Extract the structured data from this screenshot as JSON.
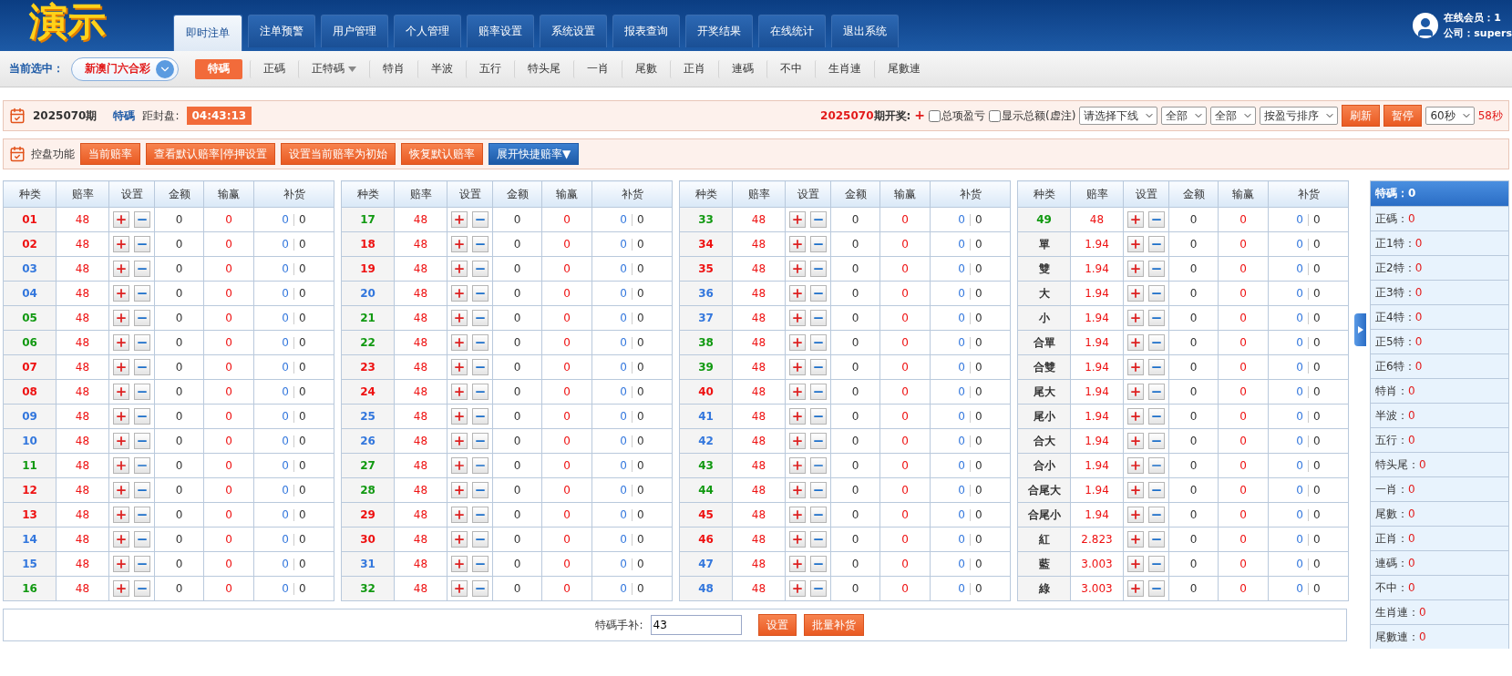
{
  "header": {
    "logo": "演示",
    "tabs": [
      {
        "label": "即时注单",
        "selected": true
      },
      {
        "label": "注单预警",
        "selected": false
      },
      {
        "label": "用户管理",
        "selected": false
      },
      {
        "label": "个人管理",
        "selected": false
      },
      {
        "label": "赔率设置",
        "selected": false
      },
      {
        "label": "系统设置",
        "selected": false
      },
      {
        "label": "报表查询",
        "selected": false
      },
      {
        "label": "开奖结果",
        "selected": false
      },
      {
        "label": "在线统计",
        "selected": false
      },
      {
        "label": "退出系统",
        "selected": false
      }
    ],
    "online": "在线会员：1",
    "company": "公司：supers"
  },
  "nav": {
    "label": "当前选中：",
    "game": "新澳门六合彩",
    "items": [
      {
        "label": "特碼",
        "selected": true,
        "kind": "link"
      },
      {
        "label": "正碼",
        "selected": false,
        "kind": "link"
      },
      {
        "label": "正特碼",
        "selected": false,
        "kind": "dropdown"
      },
      {
        "label": "特肖",
        "selected": false,
        "kind": "link"
      },
      {
        "label": "半波",
        "selected": false,
        "kind": "link"
      },
      {
        "label": "五行",
        "selected": false,
        "kind": "link"
      },
      {
        "label": "特头尾",
        "selected": false,
        "kind": "link"
      },
      {
        "label": "一肖",
        "selected": false,
        "kind": "link"
      },
      {
        "label": "尾數",
        "selected": false,
        "kind": "link"
      },
      {
        "label": "正肖",
        "selected": false,
        "kind": "link"
      },
      {
        "label": "連碼",
        "selected": false,
        "kind": "link"
      },
      {
        "label": "不中",
        "selected": false,
        "kind": "link"
      },
      {
        "label": "生肖連",
        "selected": false,
        "kind": "link"
      },
      {
        "label": "尾數連",
        "selected": false,
        "kind": "link"
      }
    ]
  },
  "info": {
    "period": "2025070期",
    "type": "特碼",
    "close_label": "距封盘:",
    "countdown": "04:43:13",
    "draw_period": "2025070",
    "draw_label": "期开奖:",
    "draw_mark": "+",
    "checkboxes": [
      {
        "label": "总项盈亏",
        "checked": false
      },
      {
        "label": "显示总额(虚注)",
        "checked": false
      }
    ],
    "selects": [
      "请选择下线",
      "全部",
      "全部",
      "按盈亏排序"
    ],
    "buttons": [
      "刷新",
      "暂停"
    ],
    "interval": "60秒",
    "remaining": "58秒"
  },
  "control": {
    "label": "控盘功能",
    "buttons": [
      {
        "label": "当前赔率",
        "kind": "orange"
      },
      {
        "label": "查看默认赔率|停押设置",
        "kind": "orange"
      },
      {
        "label": "设置当前赔率为初始",
        "kind": "orange"
      },
      {
        "label": "恢复默认赔率",
        "kind": "orange"
      },
      {
        "label": "展开快捷赔率▼",
        "kind": "blue"
      }
    ]
  },
  "tables": [
    {
      "columns": [
        "种类",
        "赔率",
        "设置",
        "金额",
        "输赢",
        "补货"
      ],
      "rows": [
        {
          "name": "01",
          "color": "#ee1111",
          "odds": "48",
          "amount": "0",
          "winloss": "0",
          "rebuy": "0",
          "rebuy_total": "0"
        },
        {
          "name": "02",
          "color": "#ee1111",
          "odds": "48",
          "amount": "0",
          "winloss": "0",
          "rebuy": "0",
          "rebuy_total": "0"
        },
        {
          "name": "03",
          "color": "#3377dd",
          "odds": "48",
          "amount": "0",
          "winloss": "0",
          "rebuy": "0",
          "rebuy_total": "0"
        },
        {
          "name": "04",
          "color": "#3377dd",
          "odds": "48",
          "amount": "0",
          "winloss": "0",
          "rebuy": "0",
          "rebuy_total": "0"
        },
        {
          "name": "05",
          "color": "#119911",
          "odds": "48",
          "amount": "0",
          "winloss": "0",
          "rebuy": "0",
          "rebuy_total": "0"
        },
        {
          "name": "06",
          "color": "#119911",
          "odds": "48",
          "amount": "0",
          "winloss": "0",
          "rebuy": "0",
          "rebuy_total": "0"
        },
        {
          "name": "07",
          "color": "#ee1111",
          "odds": "48",
          "amount": "0",
          "winloss": "0",
          "rebuy": "0",
          "rebuy_total": "0"
        },
        {
          "name": "08",
          "color": "#ee1111",
          "odds": "48",
          "amount": "0",
          "winloss": "0",
          "rebuy": "0",
          "rebuy_total": "0"
        },
        {
          "name": "09",
          "color": "#3377dd",
          "odds": "48",
          "amount": "0",
          "winloss": "0",
          "rebuy": "0",
          "rebuy_total": "0"
        },
        {
          "name": "10",
          "color": "#3377dd",
          "odds": "48",
          "amount": "0",
          "winloss": "0",
          "rebuy": "0",
          "rebuy_total": "0"
        },
        {
          "name": "11",
          "color": "#119911",
          "odds": "48",
          "amount": "0",
          "winloss": "0",
          "rebuy": "0",
          "rebuy_total": "0"
        },
        {
          "name": "12",
          "color": "#ee1111",
          "odds": "48",
          "amount": "0",
          "winloss": "0",
          "rebuy": "0",
          "rebuy_total": "0"
        },
        {
          "name": "13",
          "color": "#ee1111",
          "odds": "48",
          "amount": "0",
          "winloss": "0",
          "rebuy": "0",
          "rebuy_total": "0"
        },
        {
          "name": "14",
          "color": "#3377dd",
          "odds": "48",
          "amount": "0",
          "winloss": "0",
          "rebuy": "0",
          "rebuy_total": "0"
        },
        {
          "name": "15",
          "color": "#3377dd",
          "odds": "48",
          "amount": "0",
          "winloss": "0",
          "rebuy": "0",
          "rebuy_total": "0"
        },
        {
          "name": "16",
          "color": "#119911",
          "odds": "48",
          "amount": "0",
          "winloss": "0",
          "rebuy": "0",
          "rebuy_total": "0"
        }
      ]
    },
    {
      "columns": [
        "种类",
        "赔率",
        "设置",
        "金额",
        "输赢",
        "补货"
      ],
      "rows": [
        {
          "name": "17",
          "color": "#119911",
          "odds": "48",
          "amount": "0",
          "winloss": "0",
          "rebuy": "0",
          "rebuy_total": "0"
        },
        {
          "name": "18",
          "color": "#ee1111",
          "odds": "48",
          "amount": "0",
          "winloss": "0",
          "rebuy": "0",
          "rebuy_total": "0"
        },
        {
          "name": "19",
          "color": "#ee1111",
          "odds": "48",
          "amount": "0",
          "winloss": "0",
          "rebuy": "0",
          "rebuy_total": "0"
        },
        {
          "name": "20",
          "color": "#3377dd",
          "odds": "48",
          "amount": "0",
          "winloss": "0",
          "rebuy": "0",
          "rebuy_total": "0"
        },
        {
          "name": "21",
          "color": "#119911",
          "odds": "48",
          "amount": "0",
          "winloss": "0",
          "rebuy": "0",
          "rebuy_total": "0"
        },
        {
          "name": "22",
          "color": "#119911",
          "odds": "48",
          "amount": "0",
          "winloss": "0",
          "rebuy": "0",
          "rebuy_total": "0"
        },
        {
          "name": "23",
          "color": "#ee1111",
          "odds": "48",
          "amount": "0",
          "winloss": "0",
          "rebuy": "0",
          "rebuy_total": "0"
        },
        {
          "name": "24",
          "color": "#ee1111",
          "odds": "48",
          "amount": "0",
          "winloss": "0",
          "rebuy": "0",
          "rebuy_total": "0"
        },
        {
          "name": "25",
          "color": "#3377dd",
          "odds": "48",
          "amount": "0",
          "winloss": "0",
          "rebuy": "0",
          "rebuy_total": "0"
        },
        {
          "name": "26",
          "color": "#3377dd",
          "odds": "48",
          "amount": "0",
          "winloss": "0",
          "rebuy": "0",
          "rebuy_total": "0"
        },
        {
          "name": "27",
          "color": "#119911",
          "odds": "48",
          "amount": "0",
          "winloss": "0",
          "rebuy": "0",
          "rebuy_total": "0"
        },
        {
          "name": "28",
          "color": "#119911",
          "odds": "48",
          "amount": "0",
          "winloss": "0",
          "rebuy": "0",
          "rebuy_total": "0"
        },
        {
          "name": "29",
          "color": "#ee1111",
          "odds": "48",
          "amount": "0",
          "winloss": "0",
          "rebuy": "0",
          "rebuy_total": "0"
        },
        {
          "name": "30",
          "color": "#ee1111",
          "odds": "48",
          "amount": "0",
          "winloss": "0",
          "rebuy": "0",
          "rebuy_total": "0"
        },
        {
          "name": "31",
          "color": "#3377dd",
          "odds": "48",
          "amount": "0",
          "winloss": "0",
          "rebuy": "0",
          "rebuy_total": "0"
        },
        {
          "name": "32",
          "color": "#119911",
          "odds": "48",
          "amount": "0",
          "winloss": "0",
          "rebuy": "0",
          "rebuy_total": "0"
        }
      ]
    },
    {
      "columns": [
        "种类",
        "赔率",
        "设置",
        "金额",
        "输赢",
        "补货"
      ],
      "rows": [
        {
          "name": "33",
          "color": "#119911",
          "odds": "48",
          "amount": "0",
          "winloss": "0",
          "rebuy": "0",
          "rebuy_total": "0"
        },
        {
          "name": "34",
          "color": "#ee1111",
          "odds": "48",
          "amount": "0",
          "winloss": "0",
          "rebuy": "0",
          "rebuy_total": "0"
        },
        {
          "name": "35",
          "color": "#ee1111",
          "odds": "48",
          "amount": "0",
          "winloss": "0",
          "rebuy": "0",
          "rebuy_total": "0"
        },
        {
          "name": "36",
          "color": "#3377dd",
          "odds": "48",
          "amount": "0",
          "winloss": "0",
          "rebuy": "0",
          "rebuy_total": "0"
        },
        {
          "name": "37",
          "color": "#3377dd",
          "odds": "48",
          "amount": "0",
          "winloss": "0",
          "rebuy": "0",
          "rebuy_total": "0"
        },
        {
          "name": "38",
          "color": "#119911",
          "odds": "48",
          "amount": "0",
          "winloss": "0",
          "rebuy": "0",
          "rebuy_total": "0"
        },
        {
          "name": "39",
          "color": "#119911",
          "odds": "48",
          "amount": "0",
          "winloss": "0",
          "rebuy": "0",
          "rebuy_total": "0"
        },
        {
          "name": "40",
          "color": "#ee1111",
          "odds": "48",
          "amount": "0",
          "winloss": "0",
          "rebuy": "0",
          "rebuy_total": "0"
        },
        {
          "name": "41",
          "color": "#3377dd",
          "odds": "48",
          "amount": "0",
          "winloss": "0",
          "rebuy": "0",
          "rebuy_total": "0"
        },
        {
          "name": "42",
          "color": "#3377dd",
          "odds": "48",
          "amount": "0",
          "winloss": "0",
          "rebuy": "0",
          "rebuy_total": "0"
        },
        {
          "name": "43",
          "color": "#119911",
          "odds": "48",
          "amount": "0",
          "winloss": "0",
          "rebuy": "0",
          "rebuy_total": "0"
        },
        {
          "name": "44",
          "color": "#119911",
          "odds": "48",
          "amount": "0",
          "winloss": "0",
          "rebuy": "0",
          "rebuy_total": "0"
        },
        {
          "name": "45",
          "color": "#ee1111",
          "odds": "48",
          "amount": "0",
          "winloss": "0",
          "rebuy": "0",
          "rebuy_total": "0"
        },
        {
          "name": "46",
          "color": "#ee1111",
          "odds": "48",
          "amount": "0",
          "winloss": "0",
          "rebuy": "0",
          "rebuy_total": "0"
        },
        {
          "name": "47",
          "color": "#3377dd",
          "odds": "48",
          "amount": "0",
          "winloss": "0",
          "rebuy": "0",
          "rebuy_total": "0"
        },
        {
          "name": "48",
          "color": "#3377dd",
          "odds": "48",
          "amount": "0",
          "winloss": "0",
          "rebuy": "0",
          "rebuy_total": "0"
        }
      ]
    },
    {
      "columns": [
        "种类",
        "赔率",
        "设置",
        "金额",
        "输赢",
        "补货"
      ],
      "rows": [
        {
          "name": "49",
          "color": "#119911",
          "odds": "48",
          "amount": "0",
          "winloss": "0",
          "rebuy": "0",
          "rebuy_total": "0"
        },
        {
          "name": "單",
          "color": "#333333",
          "odds": "1.94",
          "amount": "0",
          "winloss": "0",
          "rebuy": "0",
          "rebuy_total": "0"
        },
        {
          "name": "雙",
          "color": "#333333",
          "odds": "1.94",
          "amount": "0",
          "winloss": "0",
          "rebuy": "0",
          "rebuy_total": "0"
        },
        {
          "name": "大",
          "color": "#333333",
          "odds": "1.94",
          "amount": "0",
          "winloss": "0",
          "rebuy": "0",
          "rebuy_total": "0"
        },
        {
          "name": "小",
          "color": "#333333",
          "odds": "1.94",
          "amount": "0",
          "winloss": "0",
          "rebuy": "0",
          "rebuy_total": "0"
        },
        {
          "name": "合單",
          "color": "#333333",
          "odds": "1.94",
          "amount": "0",
          "winloss": "0",
          "rebuy": "0",
          "rebuy_total": "0"
        },
        {
          "name": "合雙",
          "color": "#333333",
          "odds": "1.94",
          "amount": "0",
          "winloss": "0",
          "rebuy": "0",
          "rebuy_total": "0"
        },
        {
          "name": "尾大",
          "color": "#333333",
          "odds": "1.94",
          "amount": "0",
          "winloss": "0",
          "rebuy": "0",
          "rebuy_total": "0"
        },
        {
          "name": "尾小",
          "color": "#333333",
          "odds": "1.94",
          "amount": "0",
          "winloss": "0",
          "rebuy": "0",
          "rebuy_total": "0"
        },
        {
          "name": "合大",
          "color": "#333333",
          "odds": "1.94",
          "amount": "0",
          "winloss": "0",
          "rebuy": "0",
          "rebuy_total": "0"
        },
        {
          "name": "合小",
          "color": "#333333",
          "odds": "1.94",
          "amount": "0",
          "winloss": "0",
          "rebuy": "0",
          "rebuy_total": "0"
        },
        {
          "name": "合尾大",
          "color": "#333333",
          "odds": "1.94",
          "amount": "0",
          "winloss": "0",
          "rebuy": "0",
          "rebuy_total": "0"
        },
        {
          "name": "合尾小",
          "color": "#333333",
          "odds": "1.94",
          "amount": "0",
          "winloss": "0",
          "rebuy": "0",
          "rebuy_total": "0"
        },
        {
          "name": "紅",
          "color": "#333333",
          "odds": "2.823",
          "amount": "0",
          "winloss": "0",
          "rebuy": "0",
          "rebuy_total": "0"
        },
        {
          "name": "藍",
          "color": "#333333",
          "odds": "3.003",
          "amount": "0",
          "winloss": "0",
          "rebuy": "0",
          "rebuy_total": "0"
        },
        {
          "name": "綠",
          "color": "#333333",
          "odds": "3.003",
          "amount": "0",
          "winloss": "0",
          "rebuy": "0",
          "rebuy_total": "0"
        }
      ]
    }
  ],
  "manual": {
    "label": "特碼手补:",
    "value": "43",
    "buttons": [
      "设置",
      "批量补货"
    ]
  },
  "sidebar": {
    "title": "特碼：0",
    "items": [
      {
        "label": "正碼：",
        "value": "0"
      },
      {
        "label": "正1特：",
        "value": "0"
      },
      {
        "label": "正2特：",
        "value": "0"
      },
      {
        "label": "正3特：",
        "value": "0"
      },
      {
        "label": "正4特：",
        "value": "0"
      },
      {
        "label": "正5特：",
        "value": "0"
      },
      {
        "label": "正6特：",
        "value": "0"
      },
      {
        "label": "特肖：",
        "value": "0"
      },
      {
        "label": "半波：",
        "value": "0"
      },
      {
        "label": "五行：",
        "value": "0"
      },
      {
        "label": "特头尾：",
        "value": "0"
      },
      {
        "label": "一肖：",
        "value": "0"
      },
      {
        "label": "尾數：",
        "value": "0"
      },
      {
        "label": "正肖：",
        "value": "0"
      },
      {
        "label": "連碼：",
        "value": "0"
      },
      {
        "label": "不中：",
        "value": "0"
      },
      {
        "label": "生肖連：",
        "value": "0"
      },
      {
        "label": "尾數連：",
        "value": "0"
      }
    ]
  }
}
